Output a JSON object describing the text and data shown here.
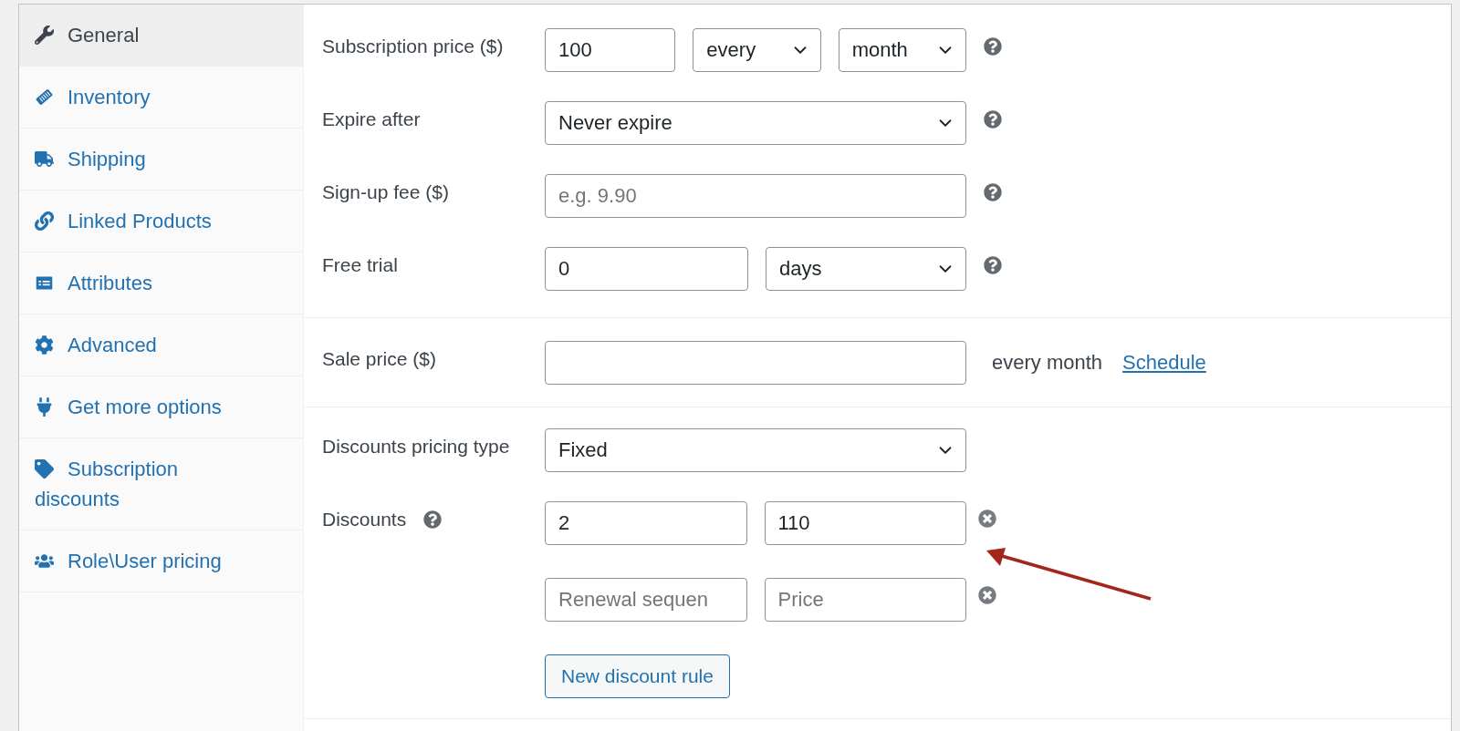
{
  "sidebar": {
    "items": [
      {
        "label": "General",
        "selected": true
      },
      {
        "label": "Inventory",
        "selected": false
      },
      {
        "label": "Shipping",
        "selected": false
      },
      {
        "label": "Linked Products",
        "selected": false
      },
      {
        "label": "Attributes",
        "selected": false
      },
      {
        "label": "Advanced",
        "selected": false
      },
      {
        "label": "Get more options",
        "selected": false
      },
      {
        "label": "Subscription discounts",
        "selected": false
      },
      {
        "label": "Role\\User pricing",
        "selected": false
      }
    ]
  },
  "sections": [
    {
      "rows": [
        {
          "kind": "field",
          "label": "Subscription price ($)",
          "controls": [
            {
              "kind": "input",
              "value": "100"
            },
            {
              "kind": "select",
              "value": "every"
            },
            {
              "kind": "select",
              "value": "month"
            }
          ],
          "extras": [
            {
              "kind": "help"
            }
          ]
        },
        {
          "kind": "field",
          "label": "Expire after",
          "controls": [
            {
              "kind": "select",
              "value": "Never expire"
            }
          ],
          "extras": [
            {
              "kind": "help"
            }
          ]
        },
        {
          "kind": "field",
          "label": "Sign-up fee ($)",
          "controls": [
            {
              "kind": "input",
              "placeholder": "e.g. 9.90"
            }
          ],
          "extras": [
            {
              "kind": "help"
            }
          ]
        },
        {
          "kind": "field",
          "label": "Free trial",
          "controls": [
            {
              "kind": "input",
              "value": "0"
            },
            {
              "kind": "select",
              "value": "days"
            }
          ],
          "extras": [
            {
              "kind": "help"
            }
          ]
        }
      ]
    },
    {
      "rows": [
        {
          "kind": "field",
          "label": "Sale price ($)",
          "controls": [
            {
              "kind": "input"
            }
          ],
          "extras": [
            {
              "kind": "text",
              "text": "every month"
            },
            {
              "kind": "link",
              "text": "Schedule"
            }
          ]
        }
      ]
    },
    {
      "rows": [
        {
          "kind": "field",
          "label": "Discounts pricing type",
          "controls": [
            {
              "kind": "select",
              "value": "Fixed"
            }
          ]
        },
        {
          "kind": "rules",
          "label": "Discounts",
          "label_help": true,
          "rules": [
            {
              "fields": [
                {
                  "value": "2"
                },
                {
                  "value": "110"
                }
              ]
            },
            {
              "fields": [
                {
                  "placeholder": "Renewal sequen"
                },
                {
                  "placeholder": "Price"
                }
              ]
            }
          ],
          "button": "New discount rule"
        }
      ]
    }
  ],
  "annotations": [
    {
      "kind": "arrow"
    }
  ]
}
